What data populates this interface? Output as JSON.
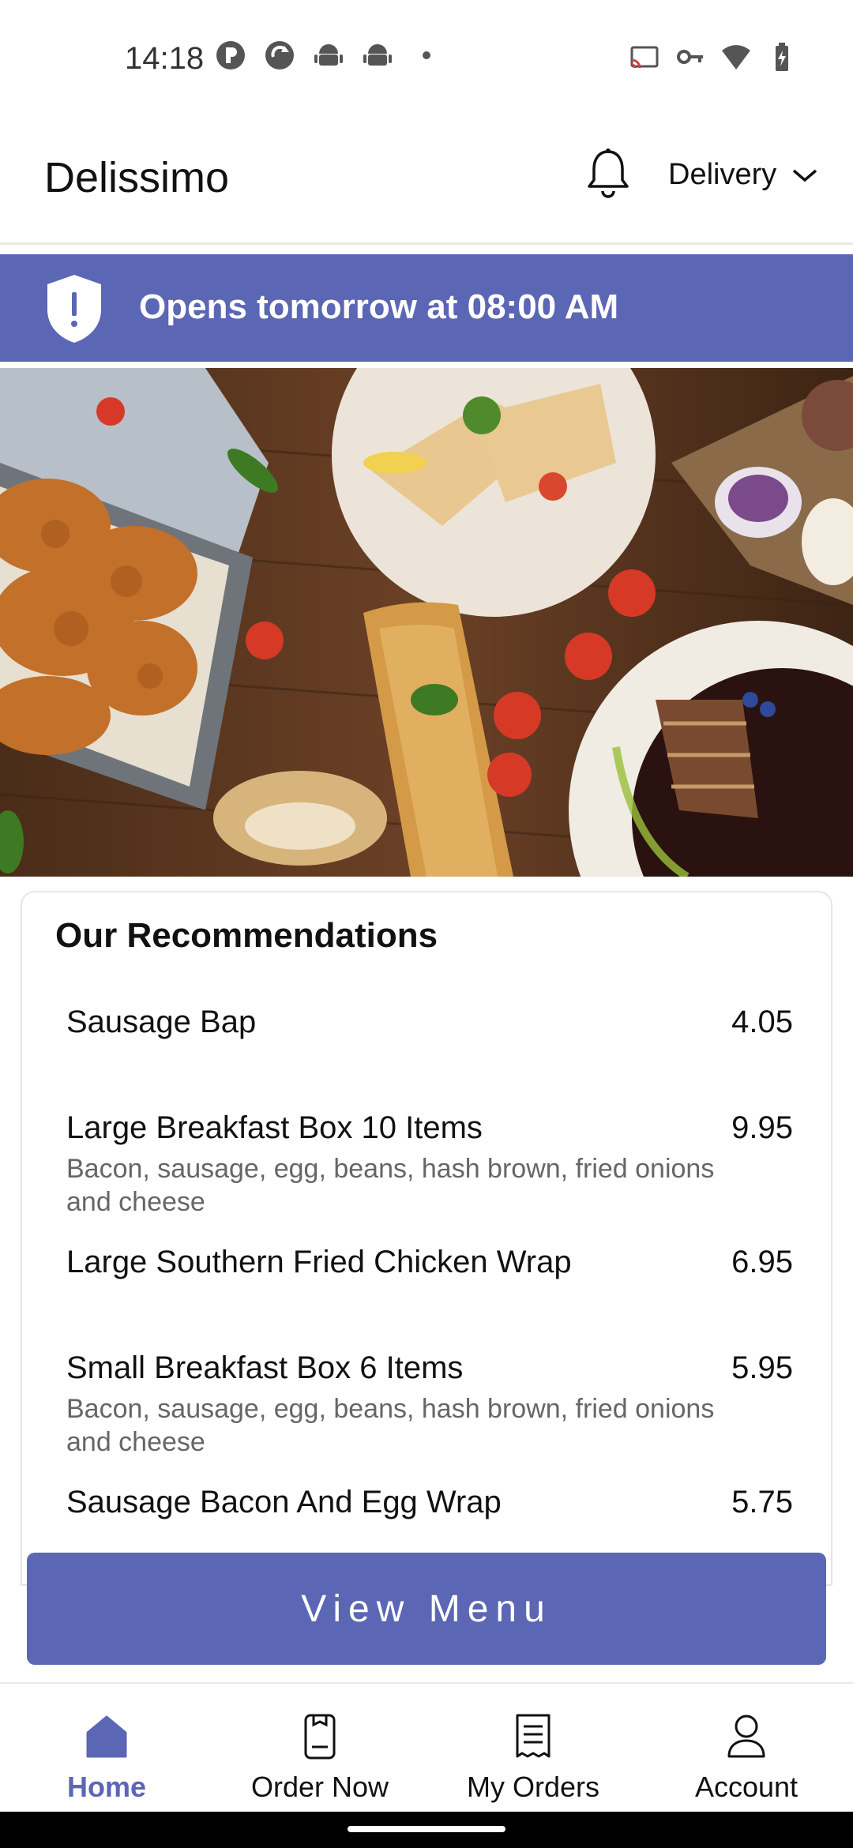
{
  "status_bar": {
    "time": "14:18",
    "left_icons": [
      "app-p-icon",
      "app-refresh-icon",
      "android-icon",
      "android-icon",
      "dot-icon"
    ],
    "right_icons": [
      "cast-icon",
      "vpn-key-icon",
      "wifi-icon",
      "battery-icon"
    ]
  },
  "app_bar": {
    "title": "Delissimo",
    "notification_icon": "bell-icon",
    "mode_label": "Delivery"
  },
  "banner": {
    "text": "Opens tomorrow at 08:00 AM",
    "icon": "shield-alert-icon",
    "color": "#5b66b5"
  },
  "recommendations": {
    "title": "Our Recommendations",
    "items": [
      {
        "name": "Sausage Bap",
        "price": "4.05",
        "description": ""
      },
      {
        "name": "Large Breakfast Box 10 Items",
        "price": "9.95",
        "description": "Bacon, sausage, egg, beans, hash brown, fried onions and cheese"
      },
      {
        "name": "Large Southern Fried Chicken Wrap",
        "price": "6.95",
        "description": ""
      },
      {
        "name": "Small Breakfast Box 6 Items",
        "price": "5.95",
        "description": "Bacon, sausage, egg, beans, hash brown, fried onions and cheese"
      },
      {
        "name": "Sausage Bacon And Egg Wrap",
        "price": "5.75",
        "description": ""
      }
    ]
  },
  "view_menu_label": "View Menu",
  "bottom_nav": {
    "items": [
      {
        "label": "Home",
        "icon": "home-icon",
        "active": true
      },
      {
        "label": "Order Now",
        "icon": "order-now-icon",
        "active": false
      },
      {
        "label": "My Orders",
        "icon": "receipt-icon",
        "active": false
      },
      {
        "label": "Account",
        "icon": "account-icon",
        "active": false
      }
    ]
  },
  "colors": {
    "accent": "#5b66b5",
    "text": "#111111",
    "muted": "#666666"
  }
}
